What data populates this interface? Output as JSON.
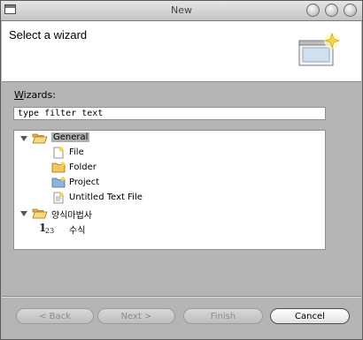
{
  "window": {
    "title": "New"
  },
  "header": {
    "title": "Select a wizard"
  },
  "filter": {
    "label": "Wizards:",
    "value": "type filter text"
  },
  "tree": {
    "items": [
      {
        "label": "General",
        "icon": "folder-open-icon",
        "expanded": true,
        "selected": true
      },
      {
        "label": "File",
        "icon": "file-icon"
      },
      {
        "label": "Folder",
        "icon": "folder-icon"
      },
      {
        "label": "Project",
        "icon": "project-icon"
      },
      {
        "label": "Untitled Text File",
        "icon": "text-file-icon"
      },
      {
        "label": "양식마법사",
        "icon": "folder-open-icon",
        "expanded": true
      },
      {
        "label": "수식",
        "icon": "number-format-icon"
      }
    ]
  },
  "buttons": {
    "back": "< Back",
    "next": "Next >",
    "finish": "Finish",
    "cancel": "Cancel"
  }
}
